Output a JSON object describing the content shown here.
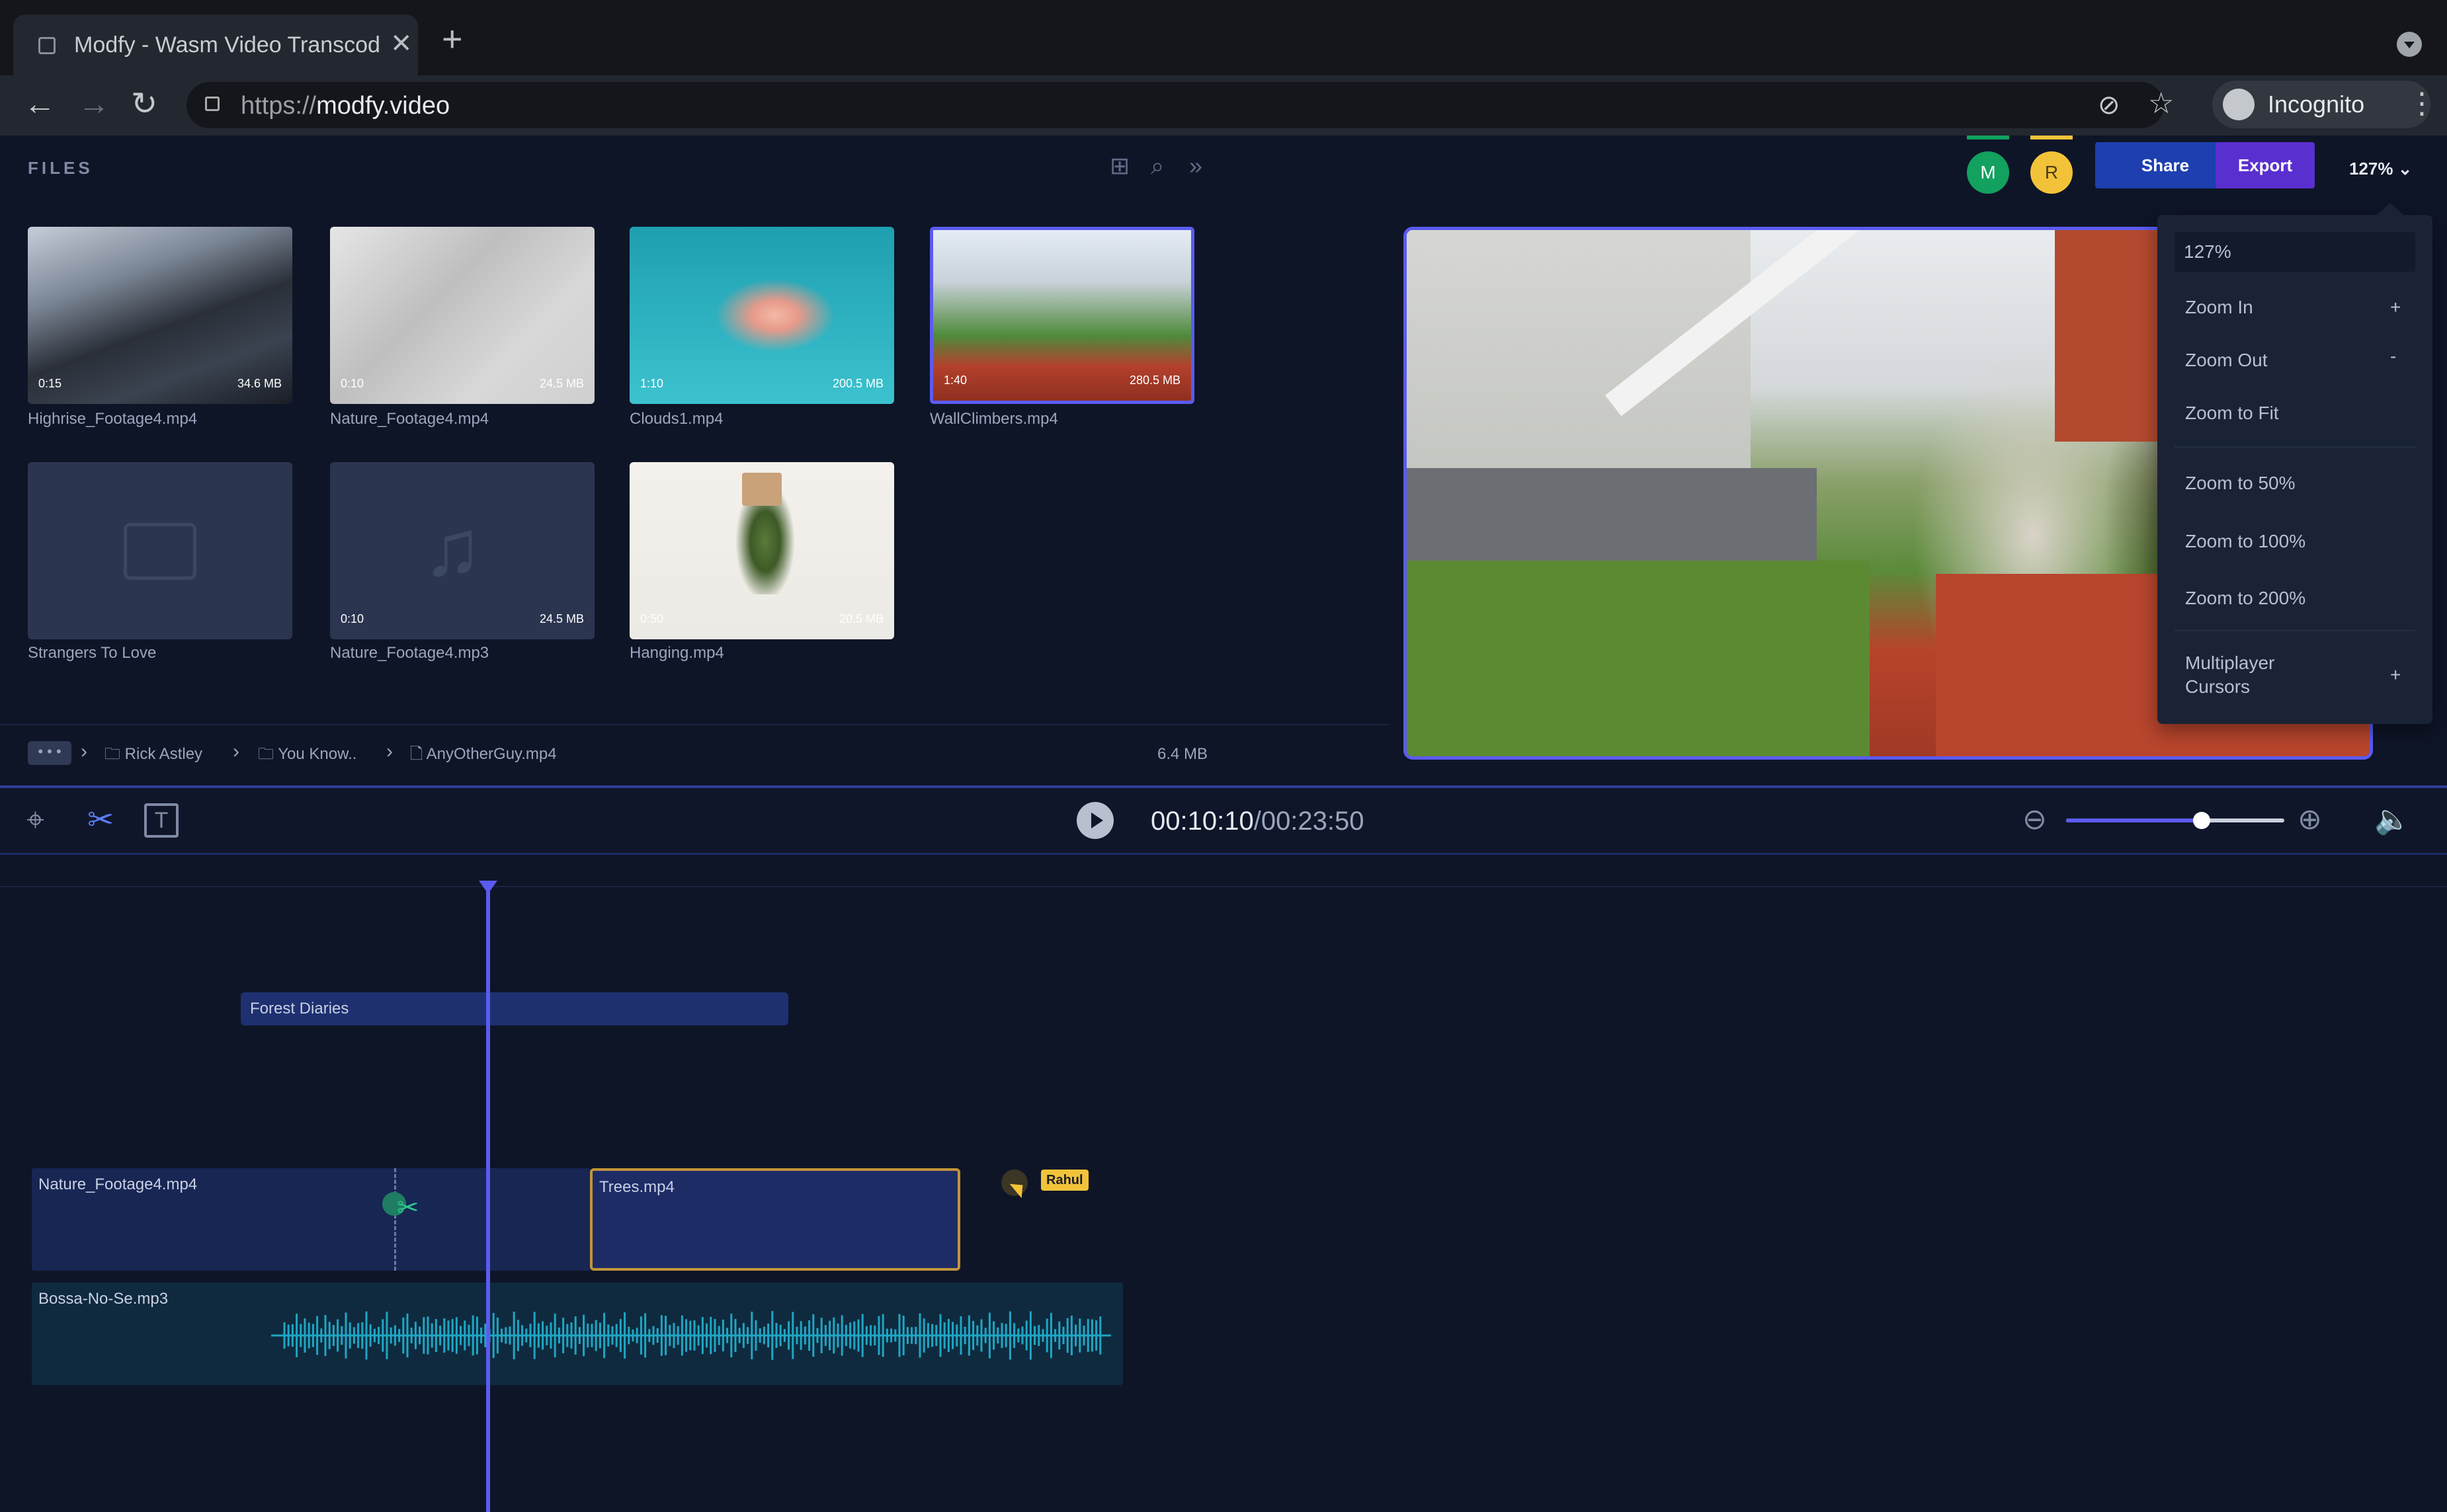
{
  "browser": {
    "tab_title": "Modfy - Wasm Video Transcod",
    "url_scheme": "https://",
    "url_host": "modfy.video",
    "profile_label": "Incognito",
    "new_tab_glyph": "+",
    "tab_close_glyph": "✕"
  },
  "files_panel": {
    "label": "FILES",
    "files": [
      {
        "name": "Highrise_Footage4.mp4",
        "duration": "0:15",
        "size": "34.6 MB"
      },
      {
        "name": "Nature_Footage4.mp4",
        "duration": "0:10",
        "size": "24.5 MB"
      },
      {
        "name": "Clouds1.mp4",
        "duration": "1:10",
        "size": "200.5 MB"
      },
      {
        "name": "WallClimbers.mp4",
        "duration": "1:40",
        "size": "280.5 MB"
      },
      {
        "name": "Strangers To Love",
        "duration": "",
        "size": ""
      },
      {
        "name": "Nature_Footage4.mp3",
        "duration": "0:10",
        "size": "24.5 MB"
      },
      {
        "name": "Hanging.mp4",
        "duration": "0:50",
        "size": "20.5 MB"
      }
    ],
    "breadcrumb": {
      "dots": "• • •",
      "items": [
        "Rick Astley",
        "You Know..",
        "AnyOtherGuy.mp4"
      ],
      "size": "6.4 MB"
    }
  },
  "collaborators": [
    {
      "initial": "M",
      "color": "#12a15f"
    },
    {
      "initial": "R",
      "color": "#f2c339"
    }
  ],
  "actions": {
    "share": "Share",
    "export": "Export",
    "zoom": "127% ⌄"
  },
  "zoom_menu": {
    "input_value": "127%",
    "items": [
      {
        "label": "Zoom In",
        "shortcut": "+"
      },
      {
        "label": "Zoom Out",
        "shortcut": "-"
      },
      {
        "label": "Zoom to Fit",
        "shortcut": ""
      },
      {
        "label": "Zoom to 50%",
        "shortcut": ""
      },
      {
        "label": "Zoom to 100%",
        "shortcut": ""
      },
      {
        "label": "Zoom to 200%",
        "shortcut": ""
      }
    ],
    "multiplayer_label_1": "Multiplayer",
    "multiplayer_label_2": "Cursors",
    "multiplayer_shortcut": "+"
  },
  "player": {
    "current_time": "00:10:10",
    "total_time": "/00:23:50",
    "timeline_zoom_fraction": 0.62
  },
  "timeline": {
    "group_label": "Forest Diaries",
    "clips": [
      "Nature_Footage4.mp4",
      "Trees.mp4"
    ],
    "audio_clip": "Bossa-No-Se.mp3",
    "remote_cursor_name": "Rahul"
  },
  "colors": {
    "accent": "#5b5bf0",
    "share": "#1d3fb0",
    "export": "#5a2fd0",
    "waveform": "#1fa6c4",
    "remote_cursor": "#f2c339"
  }
}
